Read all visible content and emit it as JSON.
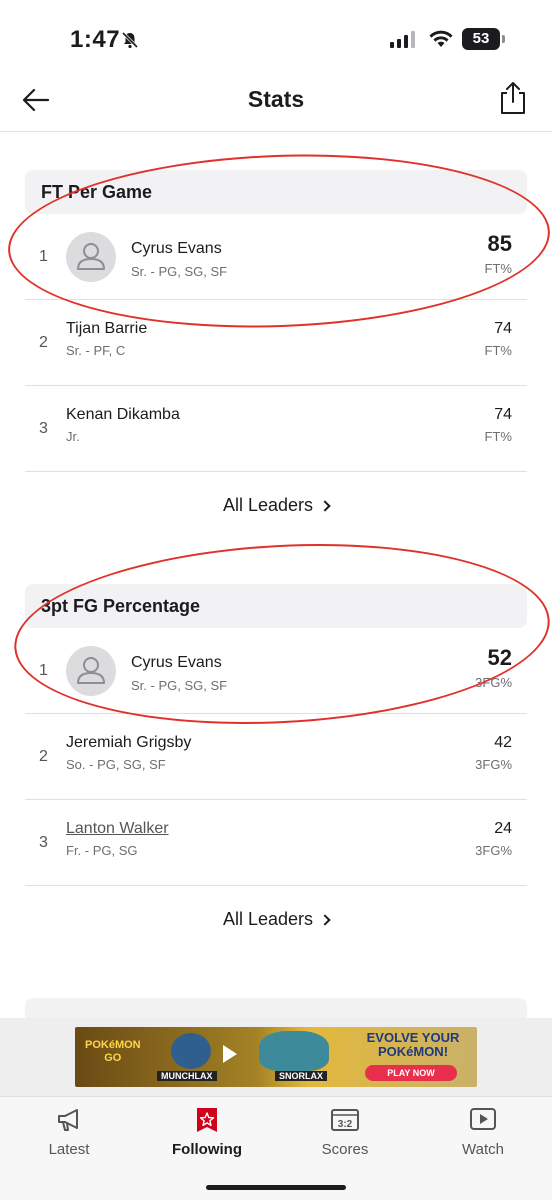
{
  "status_bar": {
    "time": "1:47",
    "battery": "53"
  },
  "header": {
    "title": "Stats"
  },
  "sections": [
    {
      "title": "FT Per Game",
      "leaders": [
        {
          "rank": "1",
          "name": "Cyrus Evans",
          "detail": "Sr. - PG, SG, SF",
          "value": "85",
          "unit": "FT%"
        },
        {
          "rank": "2",
          "name": "Tijan Barrie",
          "detail": "Sr. - PF, C",
          "value": "74",
          "unit": "FT%"
        },
        {
          "rank": "3",
          "name": "Kenan Dikamba",
          "detail": "Jr.",
          "value": "74",
          "unit": "FT%"
        }
      ],
      "all_leaders_label": "All Leaders"
    },
    {
      "title": "3pt FG Percentage",
      "leaders": [
        {
          "rank": "1",
          "name": "Cyrus Evans",
          "detail": "Sr. - PG, SG, SF",
          "value": "52",
          "unit": "3FG%"
        },
        {
          "rank": "2",
          "name": "Jeremiah Grigsby",
          "detail": "So. - PG, SG, SF",
          "value": "42",
          "unit": "3FG%"
        },
        {
          "rank": "3",
          "name": "Lanton Walker",
          "detail": "Fr. - PG, SG",
          "value": "24",
          "unit": "3FG%"
        }
      ],
      "all_leaders_label": "All Leaders"
    }
  ],
  "ad": {
    "logo_line1": "POKéMON",
    "logo_line2": "GO",
    "left_label": "MUNCHLAX",
    "right_label": "SNORLAX",
    "headline": "EVOLVE YOUR POKéMON!",
    "cta": "PLAY NOW"
  },
  "tabs": [
    {
      "label": "Latest",
      "icon": "megaphone-icon",
      "active": false
    },
    {
      "label": "Following",
      "icon": "star-icon",
      "active": true
    },
    {
      "label": "Scores",
      "icon": "scoreboard-icon",
      "active": false
    },
    {
      "label": "Watch",
      "icon": "play-icon",
      "active": false
    }
  ],
  "colors": {
    "accent": "#d0021b",
    "annotation": "#e0322a"
  }
}
